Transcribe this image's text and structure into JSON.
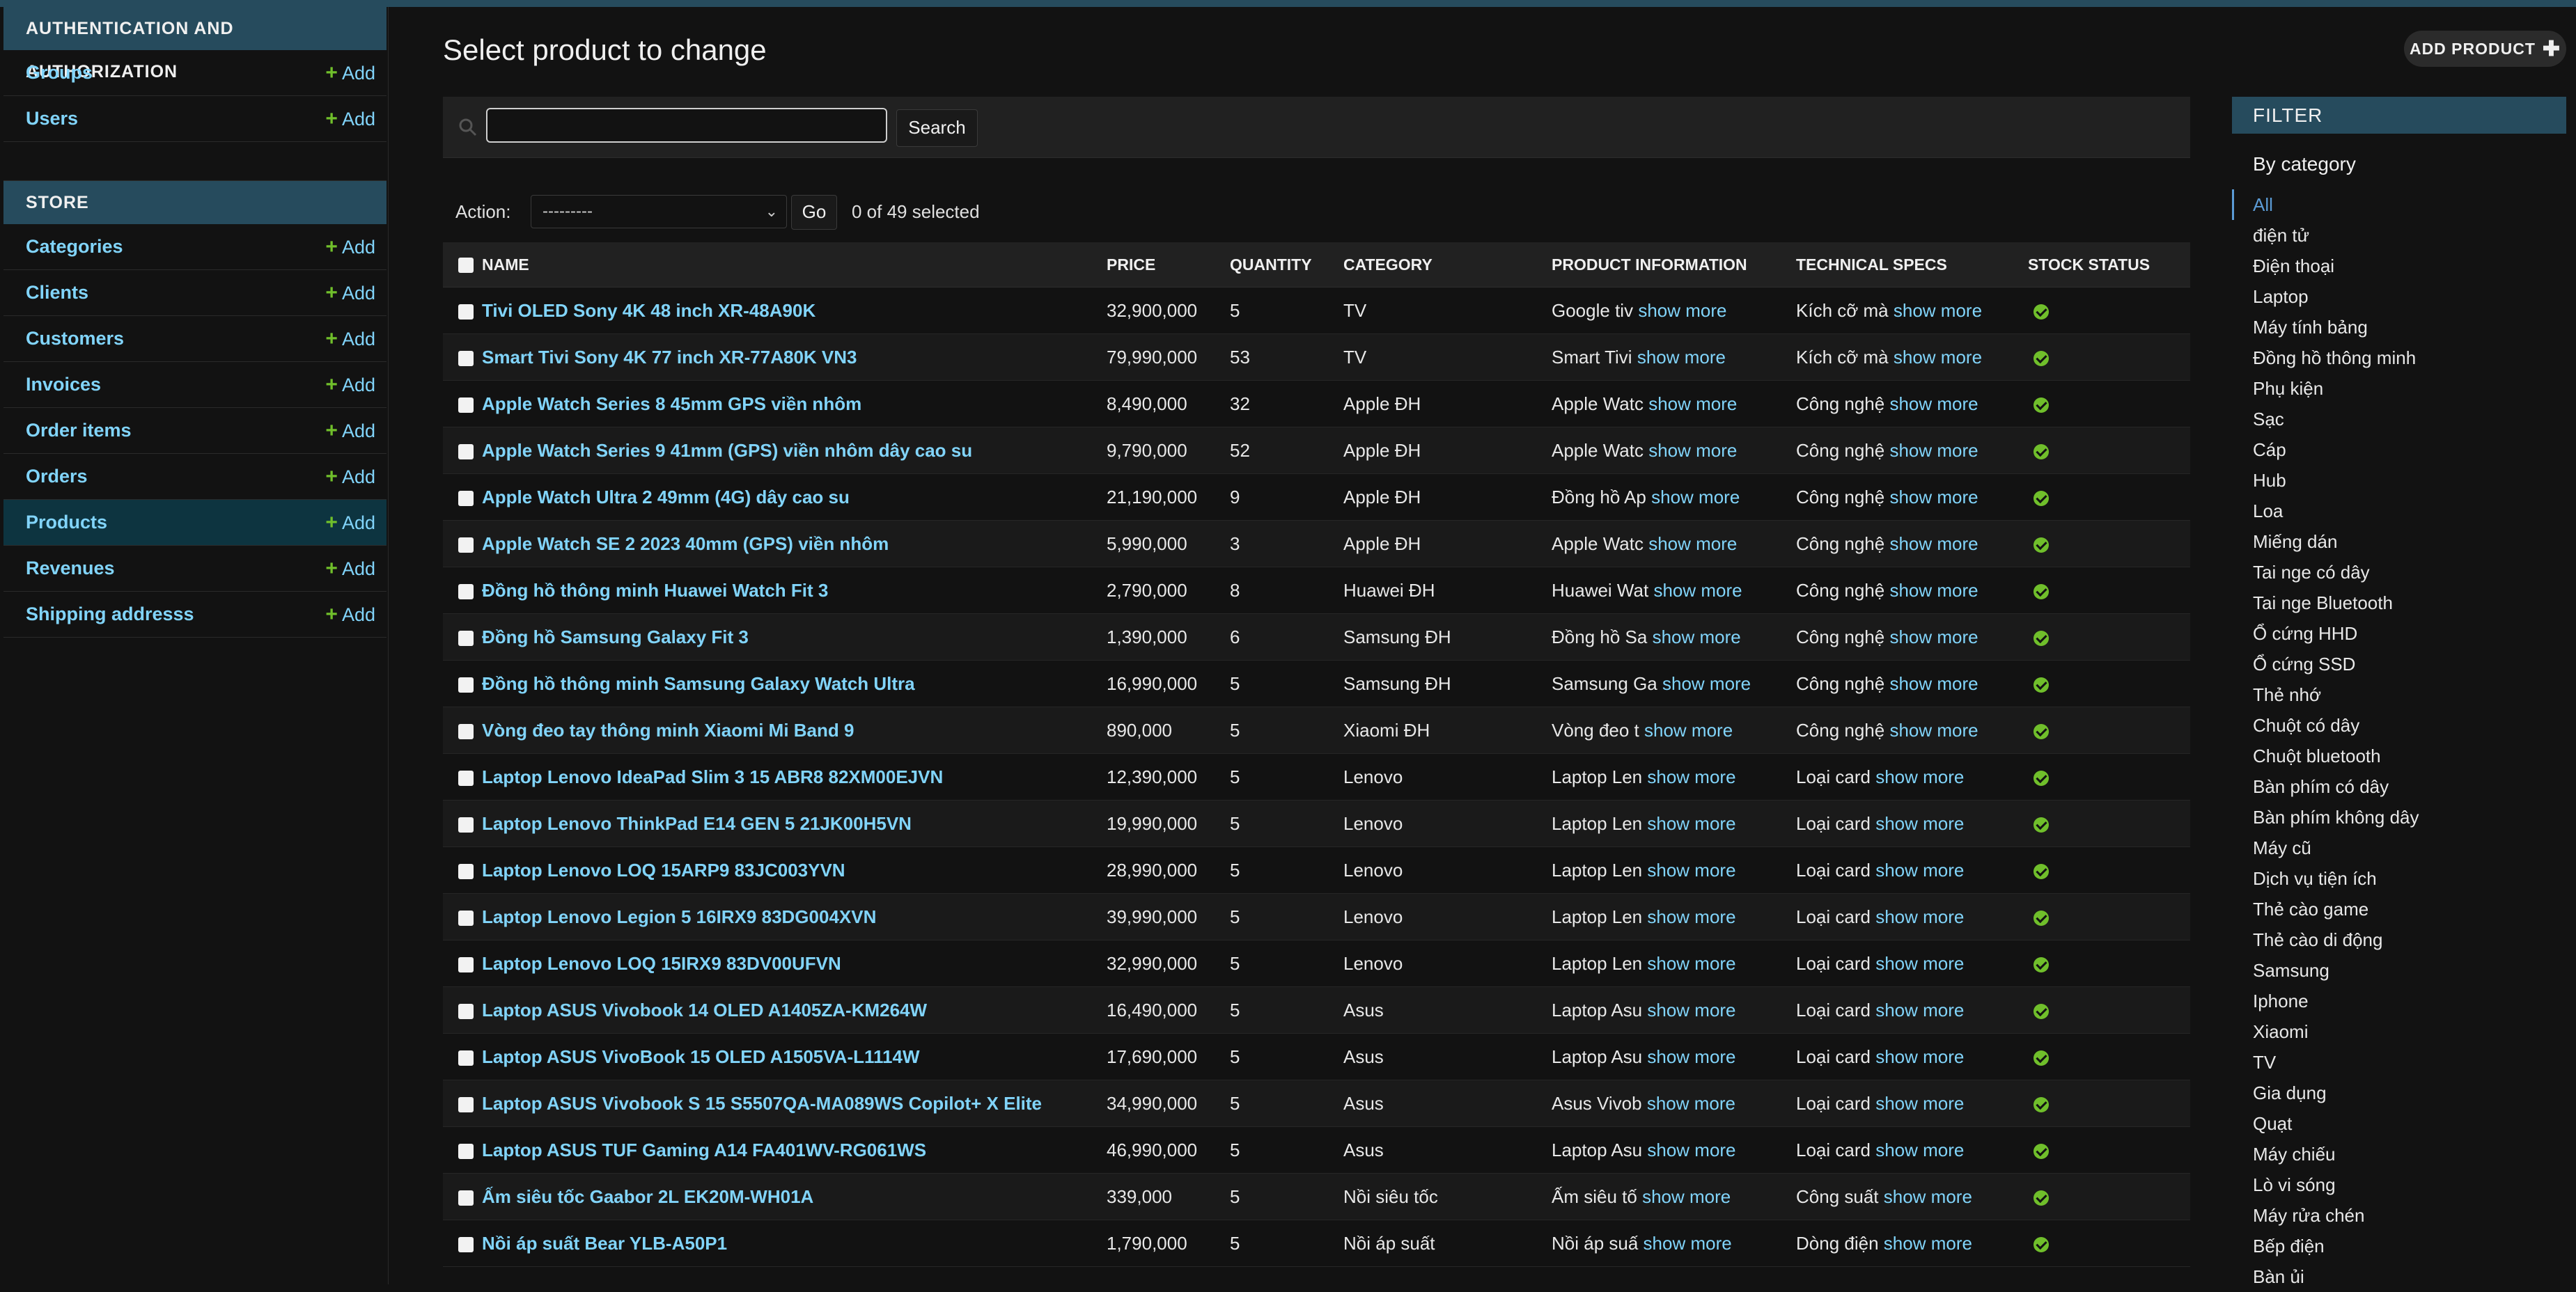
{
  "sidebar": {
    "modules": [
      {
        "caption": "Authentication and Authorization",
        "models": [
          {
            "name": "Groups",
            "add": "Add"
          },
          {
            "name": "Users",
            "add": "Add"
          }
        ]
      },
      {
        "caption": "Store",
        "models": [
          {
            "name": "Categories",
            "add": "Add"
          },
          {
            "name": "Clients",
            "add": "Add"
          },
          {
            "name": "Customers",
            "add": "Add"
          },
          {
            "name": "Invoices",
            "add": "Add"
          },
          {
            "name": "Order items",
            "add": "Add"
          },
          {
            "name": "Orders",
            "add": "Add"
          },
          {
            "name": "Products",
            "add": "Add",
            "active": true
          },
          {
            "name": "Revenues",
            "add": "Add"
          },
          {
            "name": "Shipping addresss",
            "add": "Add"
          }
        ]
      }
    ]
  },
  "page": {
    "title": "Select product to change",
    "add_button": "ADD PRODUCT"
  },
  "search": {
    "value": "",
    "button": "Search"
  },
  "actions": {
    "label": "Action:",
    "select_value": "---------",
    "go": "Go",
    "selected_text": "0 of 49 selected"
  },
  "table": {
    "headers": [
      "Name",
      "Price",
      "Quantity",
      "Category",
      "Product information",
      "Technical specs",
      "Stock status"
    ],
    "show_more": "show more",
    "rows": [
      {
        "name": "Tivi OLED Sony 4K 48 inch XR-48A90K",
        "price": "32,900,000",
        "qty": "5",
        "cat": "TV",
        "info": "Google tiv",
        "specs": "Kích cỡ mà"
      },
      {
        "name": "Smart Tivi Sony 4K 77 inch XR-77A80K VN3",
        "price": "79,990,000",
        "qty": "53",
        "cat": "TV",
        "info": "Smart Tivi",
        "specs": "Kích cỡ mà"
      },
      {
        "name": "Apple Watch Series 8 45mm GPS viền nhôm",
        "price": "8,490,000",
        "qty": "32",
        "cat": "Apple ĐH",
        "info": "Apple Watc",
        "specs": "Công nghệ"
      },
      {
        "name": "Apple Watch Series 9 41mm (GPS) viền nhôm dây cao su",
        "price": "9,790,000",
        "qty": "52",
        "cat": "Apple ĐH",
        "info": "Apple Watc",
        "specs": "Công nghệ"
      },
      {
        "name": "Apple Watch Ultra 2 49mm (4G) dây cao su",
        "price": "21,190,000",
        "qty": "9",
        "cat": "Apple ĐH",
        "info": "Đồng hồ Ap",
        "specs": "Công nghệ"
      },
      {
        "name": "Apple Watch SE 2 2023 40mm (GPS) viền nhôm",
        "price": "5,990,000",
        "qty": "3",
        "cat": "Apple ĐH",
        "info": "Apple Watc",
        "specs": "Công nghệ"
      },
      {
        "name": "Đồng hồ thông minh Huawei Watch Fit 3",
        "price": "2,790,000",
        "qty": "8",
        "cat": "Huawei ĐH",
        "info": "Huawei Wat",
        "specs": "Công nghệ"
      },
      {
        "name": "Đồng hồ Samsung Galaxy Fit 3",
        "price": "1,390,000",
        "qty": "6",
        "cat": "Samsung ĐH",
        "info": "Đồng hồ Sa",
        "specs": "Công nghệ"
      },
      {
        "name": "Đồng hồ thông minh Samsung Galaxy Watch Ultra",
        "price": "16,990,000",
        "qty": "5",
        "cat": "Samsung ĐH",
        "info": "Samsung Ga",
        "specs": "Công nghệ"
      },
      {
        "name": "Vòng đeo tay thông minh Xiaomi Mi Band 9",
        "price": "890,000",
        "qty": "5",
        "cat": "Xiaomi ĐH",
        "info": "Vòng đeo t",
        "specs": "Công nghệ"
      },
      {
        "name": "Laptop Lenovo IdeaPad Slim 3 15 ABR8 82XM00EJVN",
        "price": "12,390,000",
        "qty": "5",
        "cat": "Lenovo",
        "info": "Laptop Len",
        "specs": "Loại card"
      },
      {
        "name": "Laptop Lenovo ThinkPad E14 GEN 5 21JK00H5VN",
        "price": "19,990,000",
        "qty": "5",
        "cat": "Lenovo",
        "info": "Laptop Len",
        "specs": "Loại card"
      },
      {
        "name": "Laptop Lenovo LOQ 15ARP9 83JC003YVN",
        "price": "28,990,000",
        "qty": "5",
        "cat": "Lenovo",
        "info": "Laptop Len",
        "specs": "Loại card"
      },
      {
        "name": "Laptop Lenovo Legion 5 16IRX9 83DG004XVN",
        "price": "39,990,000",
        "qty": "5",
        "cat": "Lenovo",
        "info": "Laptop Len",
        "specs": "Loại card"
      },
      {
        "name": "Laptop Lenovo LOQ 15IRX9 83DV00UFVN",
        "price": "32,990,000",
        "qty": "5",
        "cat": "Lenovo",
        "info": "Laptop Len",
        "specs": "Loại card"
      },
      {
        "name": "Laptop ASUS Vivobook 14 OLED A1405ZA-KM264W",
        "price": "16,490,000",
        "qty": "5",
        "cat": "Asus",
        "info": "Laptop Asu",
        "specs": "Loại card"
      },
      {
        "name": "Laptop ASUS VivoBook 15 OLED A1505VA-L1114W",
        "price": "17,690,000",
        "qty": "5",
        "cat": "Asus",
        "info": "Laptop Asu",
        "specs": "Loại card"
      },
      {
        "name": "Laptop ASUS Vivobook S 15 S5507QA-MA089WS Copilot+ X Elite",
        "price": "34,990,000",
        "qty": "5",
        "cat": "Asus",
        "info": "Asus Vivob",
        "specs": "Loại card"
      },
      {
        "name": "Laptop ASUS TUF Gaming A14 FA401WV-RG061WS",
        "price": "46,990,000",
        "qty": "5",
        "cat": "Asus",
        "info": "Laptop Asu",
        "specs": "Loại card"
      },
      {
        "name": "Ấm siêu tốc Gaabor 2L EK20M-WH01A",
        "price": "339,000",
        "qty": "5",
        "cat": "Nồi siêu tốc",
        "info": "Ấm siêu tố",
        "specs": "Công suất"
      },
      {
        "name": "Nồi áp suất Bear YLB-A50P1",
        "price": "1,790,000",
        "qty": "5",
        "cat": "Nồi áp suất",
        "info": "Nồi áp suấ",
        "specs": "Dòng điện"
      }
    ]
  },
  "filter": {
    "title": "FILTER",
    "by": "By category",
    "items": [
      "All",
      "điện tử",
      "Điện thoại",
      "Laptop",
      "Máy tính bảng",
      "Đồng hồ thông minh",
      "Phụ kiện",
      "Sạc",
      "Cáp",
      "Hub",
      "Loa",
      "Miếng dán",
      "Tai nge có dây",
      "Tai nge Bluetooth",
      "Ổ cứng HHD",
      "Ổ cứng SSD",
      "Thẻ nhớ",
      "Chuột có dây",
      "Chuột bluetooth",
      "Bàn phím có dây",
      "Bàn phím không dây",
      "Máy cũ",
      "Dịch vụ tiện ích",
      "Thẻ cào game",
      "Thẻ cào di động",
      "Samsung",
      "Iphone",
      "Xiaomi",
      "TV",
      "Gia dụng",
      "Quạt",
      "Máy chiếu",
      "Lò vi sóng",
      "Máy rửa chén",
      "Bếp điện",
      "Bàn ủi"
    ],
    "selected": "All"
  },
  "colors": {
    "header_bar": "#264b5d",
    "link": "#81d4fa",
    "add_plus": "#70bf2b",
    "background": "#121212"
  }
}
